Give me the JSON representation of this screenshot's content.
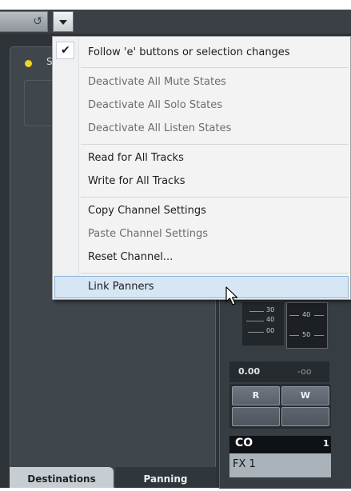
{
  "toolbar": {
    "reset_glyph": "↺"
  },
  "left_panel": {
    "label_partial": "S",
    "status_color": "#f2d31f"
  },
  "bottom_tabs": [
    {
      "label": "Destinations"
    },
    {
      "label": "Panning"
    }
  ],
  "channel_strip": {
    "meter_left_scale": [
      "30",
      "40",
      "00"
    ],
    "meter_right_scale": [
      "40",
      "50"
    ],
    "volume": "0.00",
    "peak": "-oo",
    "read_label": "R",
    "write_label": "W",
    "link_glyph": "CO",
    "link_number": "1",
    "channel_name": "FX 1"
  },
  "menu": {
    "items": [
      {
        "label": "Follow 'e' buttons or selection changes",
        "checked": true,
        "enabled": true
      },
      {
        "label": "Deactivate All Mute States",
        "enabled": false
      },
      {
        "label": "Deactivate All Solo States",
        "enabled": false
      },
      {
        "label": "Deactivate All Listen States",
        "enabled": false
      },
      {
        "label": "Read for All Tracks",
        "enabled": true
      },
      {
        "label": "Write for All Tracks",
        "enabled": true
      },
      {
        "label": "Copy Channel Settings",
        "enabled": true
      },
      {
        "label": "Paste Channel Settings",
        "enabled": false
      },
      {
        "label": "Reset Channel...",
        "enabled": true
      },
      {
        "label": "Link Panners",
        "enabled": true,
        "hovered": true
      }
    ],
    "check_glyph": "✔"
  }
}
